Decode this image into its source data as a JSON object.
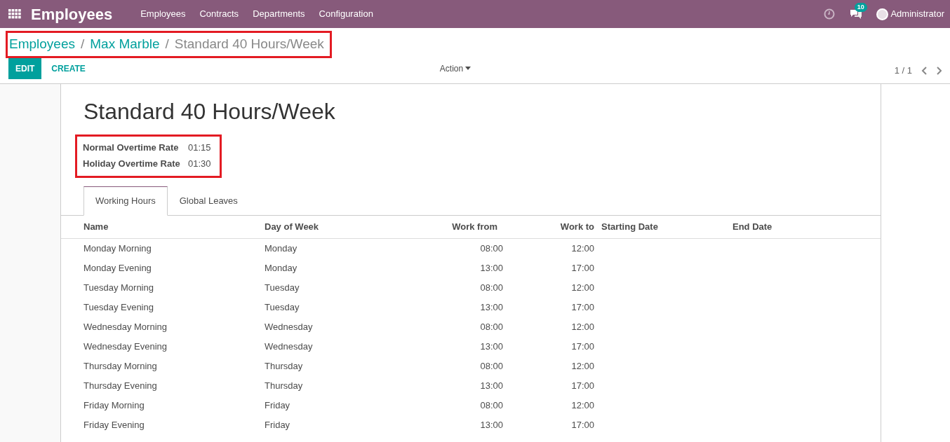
{
  "navbar": {
    "app_title": "Employees",
    "menu": [
      "Employees",
      "Contracts",
      "Departments",
      "Configuration"
    ],
    "messages_count": "10",
    "user": "Administrator"
  },
  "breadcrumb": {
    "highlighted": true,
    "separator": "/",
    "items": [
      "Employees",
      "Max Marble",
      "Standard 40 Hours/Week"
    ]
  },
  "buttons": {
    "edit": "EDIT",
    "create": "CREATE",
    "action": "Action"
  },
  "pager": "1 / 1",
  "form": {
    "title": "Standard 40 Hours/Week",
    "fields_highlighted": true,
    "fields": [
      {
        "label": "Normal Overtime Rate",
        "value": "01:15"
      },
      {
        "label": "Holiday Overtime Rate",
        "value": "01:30"
      }
    ],
    "tabs": [
      {
        "label": "Working Hours",
        "selected": true
      },
      {
        "label": "Global Leaves",
        "selected": false
      }
    ],
    "table": {
      "columns": [
        "Name",
        "Day of Week",
        "Work from",
        "Work to",
        "Starting Date",
        "End Date"
      ],
      "rows": [
        [
          "Monday Morning",
          "Monday",
          "08:00",
          "12:00"
        ],
        [
          "Monday Evening",
          "Monday",
          "13:00",
          "17:00"
        ],
        [
          "Tuesday Morning",
          "Tuesday",
          "08:00",
          "12:00"
        ],
        [
          "Tuesday Evening",
          "Tuesday",
          "13:00",
          "17:00"
        ],
        [
          "Wednesday Morning",
          "Wednesday",
          "08:00",
          "12:00"
        ],
        [
          "Wednesday Evening",
          "Wednesday",
          "13:00",
          "17:00"
        ],
        [
          "Thursday Morning",
          "Thursday",
          "08:00",
          "12:00"
        ],
        [
          "Thursday Evening",
          "Thursday",
          "13:00",
          "17:00"
        ],
        [
          "Friday Morning",
          "Friday",
          "08:00",
          "12:00"
        ],
        [
          "Friday Evening",
          "Friday",
          "13:00",
          "17:00"
        ]
      ]
    }
  }
}
